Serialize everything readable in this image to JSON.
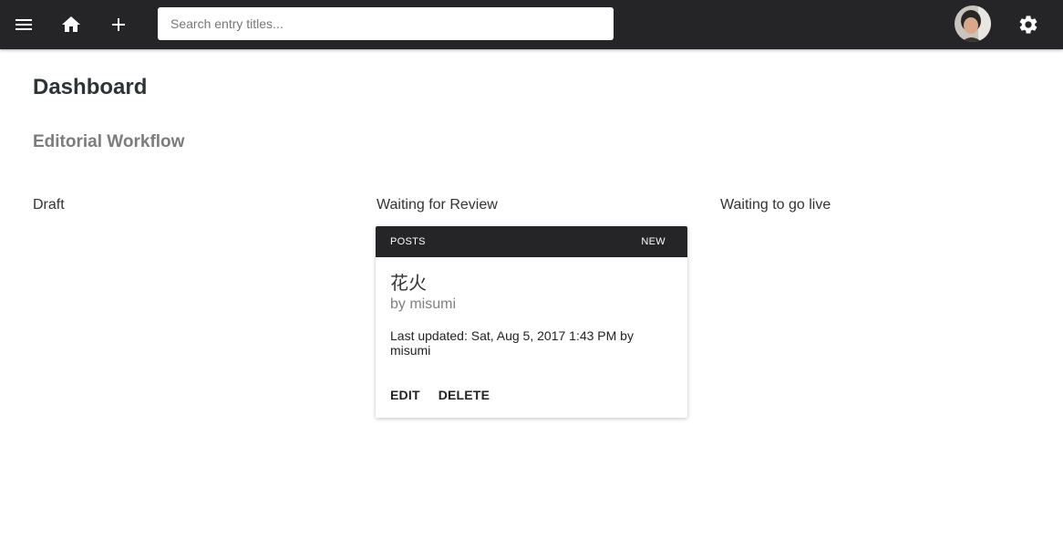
{
  "topbar": {
    "menu_icon": "menu-icon",
    "home_icon": "home-icon",
    "add_icon": "plus-icon",
    "search": {
      "placeholder": "Search entry titles...",
      "value": ""
    },
    "avatar_icon": "user-avatar",
    "settings_icon": "gear-icon"
  },
  "dashboard": {
    "title": "Dashboard",
    "section_title": "Editorial Workflow",
    "columns": [
      {
        "title": "Draft"
      },
      {
        "title": "Waiting for Review"
      },
      {
        "title": "Waiting to go live"
      }
    ]
  },
  "card": {
    "collection": "POSTS",
    "status": "NEW",
    "title": "花火",
    "author": "by misumi",
    "updated": "Last updated: Sat, Aug 5, 2017 1:43 PM by misumi",
    "edit_label": "EDIT",
    "delete_label": "DELETE"
  },
  "colors": {
    "topbar": "#252528",
    "background": "#ffffff",
    "subtitle": "#7c7c7c"
  }
}
